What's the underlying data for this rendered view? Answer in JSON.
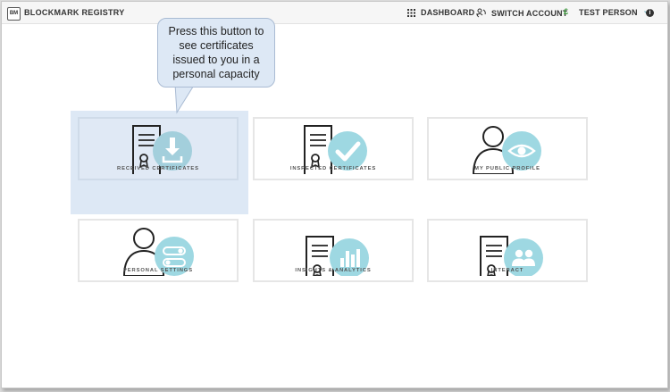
{
  "app": {
    "logo_text": "BM",
    "name": "BLOCKMARK REGISTRY"
  },
  "nav": {
    "dashboard": "DASHBOARD",
    "switch_account": "SWITCH ACCOUNT",
    "currency": "£",
    "user": "TEST PERSON",
    "info": "i"
  },
  "callout": {
    "text": "Press this button to see certificates issued to you in a personal capacity"
  },
  "tiles": [
    {
      "label": "RECEIVED CERTIFICATES",
      "icon": "certificate-download-icon"
    },
    {
      "label": "INSPECTED CERTIFICATES",
      "icon": "certificate-check-icon"
    },
    {
      "label": "MY PUBLIC PROFILE",
      "icon": "person-eye-icon"
    },
    {
      "label": "PERSONAL SETTINGS",
      "icon": "person-toggle-icon"
    },
    {
      "label": "INSIGHTS & ANALYTICS",
      "icon": "certificate-chart-icon"
    },
    {
      "label": "INTERACT",
      "icon": "certificate-people-icon"
    }
  ],
  "colors": {
    "accent_circle": "#9ed8e2",
    "highlight": "#dde8f5",
    "currency_green": "#3a9a3a"
  }
}
